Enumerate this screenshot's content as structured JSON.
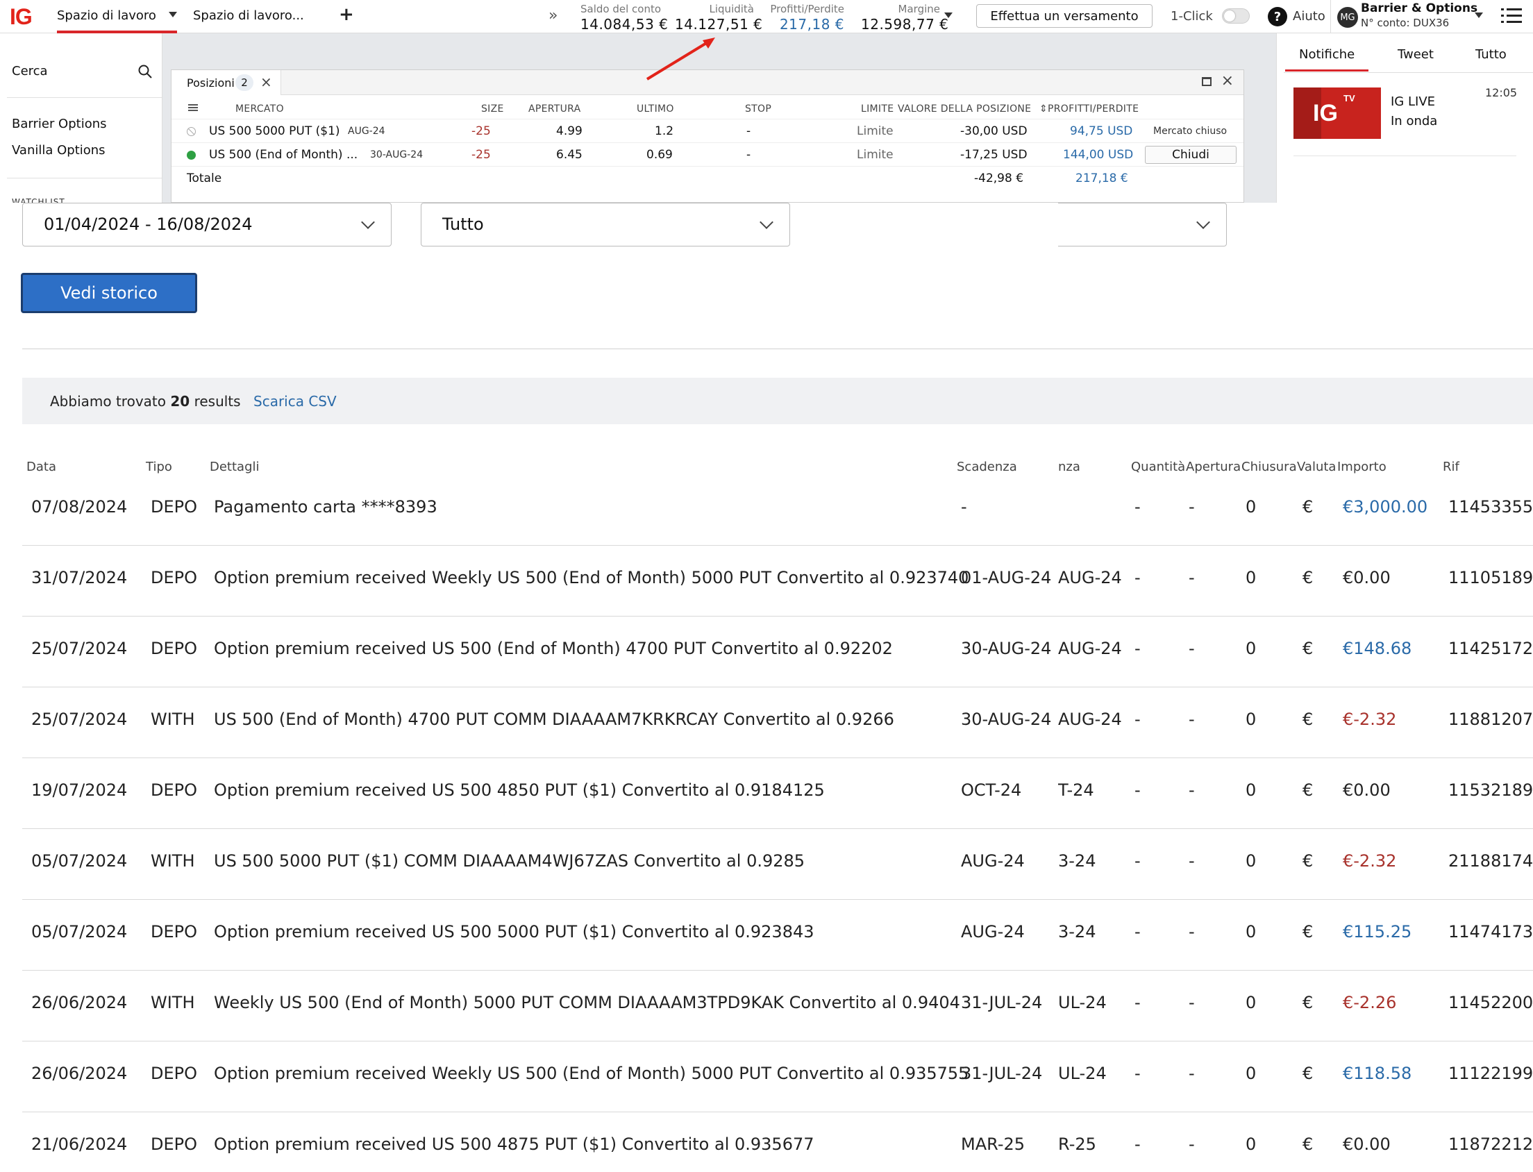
{
  "topbar": {
    "logo": "IG",
    "workspace_tab_active": "Spazio di lavoro",
    "workspace_tab_second": "Spazio di lavoro...",
    "add_tab": "+",
    "more": "»",
    "stats": [
      {
        "label": "Saldo del conto",
        "value": "14.084,53 €",
        "color": "black"
      },
      {
        "label": "Liquidità",
        "value": "14.127,51 €",
        "color": "black"
      },
      {
        "label": "Profitti/Perdite",
        "value": "217,18 €",
        "color": "blue"
      },
      {
        "label": "Margine",
        "value": "12.598,77 €",
        "color": "black"
      }
    ],
    "deposit_button": "Effettua un versamento",
    "one_click_label": "1-Click",
    "help_icon": "?",
    "help_label": "Aiuto",
    "account_initials": "MG",
    "account_name": "Barrier & Options",
    "account_number": "N° conto: DUX36"
  },
  "left_panel": {
    "search_label": "Cerca",
    "items": [
      "Barrier Options",
      "Vanilla Options"
    ],
    "watchlist_label": "WATCHLIST"
  },
  "right_panel": {
    "tabs": [
      "Notifiche",
      "Tweet",
      "Tutto"
    ],
    "live": {
      "logo": "IG",
      "tv": "TV",
      "title": "IG LIVE",
      "status": "In onda",
      "time": "12:05"
    }
  },
  "positions": {
    "tab_label": "Posizioni",
    "count": "2",
    "columns": {
      "market": "MERCATO",
      "size": "SIZE",
      "open": "APERTURA",
      "last": "ULTIMO",
      "stop": "STOP",
      "limit": "LIMITE",
      "value": "VALORE DELLA POSIZIONE",
      "pl": "PROFITTI/PERDITE"
    },
    "rows": [
      {
        "status": "closed",
        "market": "US 500 5000 PUT ($1)",
        "expiry": "AUG-24",
        "size": "-25",
        "open": "4.99",
        "last": "1.2",
        "stop": "-",
        "limit": "Limite",
        "value": "-30,00 USD",
        "pl": "94,75 USD",
        "action": "Mercato chiuso"
      },
      {
        "status": "open",
        "market": "US 500 (End of Month) ...",
        "expiry": "30-AUG-24",
        "size": "-25",
        "open": "6.45",
        "last": "0.69",
        "stop": "-",
        "limit": "Limite",
        "value": "-17,25 USD",
        "pl": "144,00 USD",
        "action": "Chiudi"
      }
    ],
    "total": {
      "label": "Totale",
      "value": "-42,98 €",
      "pl": "217,18 €"
    }
  },
  "filters": {
    "date_range": "01/04/2024 - 16/08/2024",
    "type": "Tutto",
    "third": "",
    "history_button": "Vedi storico"
  },
  "results": {
    "prefix": "Abbiamo trovato",
    "count": "20",
    "suffix": "results",
    "csv_link": "Scarica CSV"
  },
  "history": {
    "columns": {
      "date": "Data",
      "type": "Tipo",
      "details": "Dettagli",
      "expiry": "Scadenza",
      "expiry2": "nza",
      "qty": "Quantità",
      "open": "Apertura",
      "close": "Chiusura",
      "currency": "Valuta",
      "amount": "Importo",
      "ref": "Rif"
    },
    "rows": [
      {
        "date": "07/08/2024",
        "type": "DEPO",
        "details": "Pagamento carta ****8393",
        "expiry": "-",
        "expiry2": "",
        "qty": "-",
        "open": "-",
        "close": "0",
        "currency": "€",
        "amount": "€3,000.00",
        "amount_color": "blue",
        "ref": "11453355"
      },
      {
        "date": "31/07/2024",
        "type": "DEPO",
        "details": "Option premium received Weekly US 500 (End of Month) 5000 PUT Convertito al 0.9237405",
        "expiry": "01-AUG-24",
        "expiry2": "AUG-24",
        "qty": "-",
        "open": "-",
        "close": "0",
        "currency": "€",
        "amount": "€0.00",
        "amount_color": "black",
        "ref": "11105189"
      },
      {
        "date": "25/07/2024",
        "type": "DEPO",
        "details": "Option premium received US 500 (End of Month) 4700 PUT Convertito al 0.92202",
        "expiry": "30-AUG-24",
        "expiry2": "AUG-24",
        "qty": "-",
        "open": "-",
        "close": "0",
        "currency": "€",
        "amount": "€148.68",
        "amount_color": "blue",
        "ref": "11425172"
      },
      {
        "date": "25/07/2024",
        "type": "WITH",
        "details": "US 500 (End of Month) 4700 PUT COMM DIAAAAM7KRKRCAY Convertito al 0.9266",
        "expiry": "30-AUG-24",
        "expiry2": "AUG-24",
        "qty": "-",
        "open": "-",
        "close": "0",
        "currency": "€",
        "amount": "€-2.32",
        "amount_color": "red",
        "ref": "11881207"
      },
      {
        "date": "19/07/2024",
        "type": "DEPO",
        "details": "Option premium received US 500 4850 PUT ($1) Convertito al 0.9184125",
        "expiry": "OCT-24",
        "expiry2": "T-24",
        "qty": "-",
        "open": "-",
        "close": "0",
        "currency": "€",
        "amount": "€0.00",
        "amount_color": "black",
        "ref": "11532189"
      },
      {
        "date": "05/07/2024",
        "type": "WITH",
        "details": "US 500 5000 PUT ($1) COMM DIAAAAM4WJ67ZAS Convertito al 0.9285",
        "expiry": "AUG-24",
        "expiry2": "3-24",
        "qty": "-",
        "open": "-",
        "close": "0",
        "currency": "€",
        "amount": "€-2.32",
        "amount_color": "red",
        "ref": "21188174"
      },
      {
        "date": "05/07/2024",
        "type": "DEPO",
        "details": "Option premium received US 500 5000 PUT ($1) Convertito al 0.923843",
        "expiry": "AUG-24",
        "expiry2": "3-24",
        "qty": "-",
        "open": "-",
        "close": "0",
        "currency": "€",
        "amount": "€115.25",
        "amount_color": "blue",
        "ref": "11474173"
      },
      {
        "date": "26/06/2024",
        "type": "WITH",
        "details": "Weekly US 500 (End of Month) 5000 PUT COMM DIAAAAM3TPD9KAK Convertito al 0.9404",
        "expiry": "31-JUL-24",
        "expiry2": "UL-24",
        "qty": "-",
        "open": "-",
        "close": "0",
        "currency": "€",
        "amount": "€-2.26",
        "amount_color": "red",
        "ref": "11452200"
      },
      {
        "date": "26/06/2024",
        "type": "DEPO",
        "details": "Option premium received Weekly US 500 (End of Month) 5000 PUT Convertito al 0.9357555",
        "expiry": "31-JUL-24",
        "expiry2": "UL-24",
        "qty": "-",
        "open": "-",
        "close": "0",
        "currency": "€",
        "amount": "€118.58",
        "amount_color": "blue",
        "ref": "11122199"
      },
      {
        "date": "21/06/2024",
        "type": "DEPO",
        "details": "Option premium received US 500 4875 PUT ($1) Convertito al 0.935677",
        "expiry": "MAR-25",
        "expiry2": "R-25",
        "qty": "-",
        "open": "-",
        "close": "0",
        "currency": "€",
        "amount": "€0.00",
        "amount_color": "black",
        "ref": "11872212"
      }
    ]
  },
  "colors": {
    "brand": "#e2231a",
    "accent_blue": "#2a6aa8",
    "negative": "#a8322c",
    "button_blue": "#2d6fc6"
  }
}
